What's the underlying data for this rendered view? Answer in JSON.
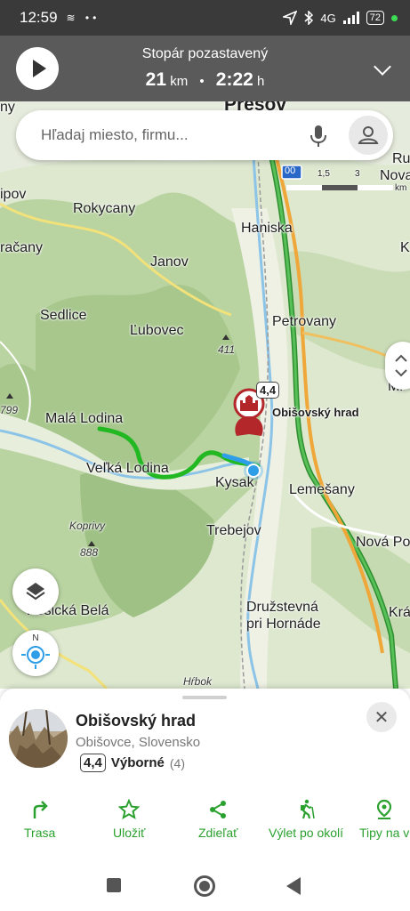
{
  "status_bar": {
    "time": "12:59",
    "left_icons": "≋ ••",
    "network": "4G",
    "battery": "72"
  },
  "tracker": {
    "title": "Stopár pozastavený",
    "distance_value": "21",
    "distance_unit": "km",
    "separator": "•",
    "duration_value": "2:22",
    "duration_unit": "h"
  },
  "search": {
    "placeholder": "Hľadaj miesto, firmu..."
  },
  "map": {
    "places": [
      {
        "id": "presov",
        "label": "Prešov"
      },
      {
        "id": "rokycany",
        "label": "Rokycany"
      },
      {
        "id": "haniska",
        "label": "Haniska"
      },
      {
        "id": "janov",
        "label": "Janov"
      },
      {
        "id": "sedlice",
        "label": "Sedlice"
      },
      {
        "id": "lubovec",
        "label": "Ľubovec"
      },
      {
        "id": "petrovany",
        "label": "Petrovany"
      },
      {
        "id": "mala-lodina",
        "label": "Malá Lodina"
      },
      {
        "id": "velka-lodina",
        "label": "Veľká Lodina"
      },
      {
        "id": "kysak",
        "label": "Kysak"
      },
      {
        "id": "lemesany",
        "label": "Lemešany"
      },
      {
        "id": "koprivy",
        "label": "Koprivy"
      },
      {
        "id": "trebejov",
        "label": "Trebejov"
      },
      {
        "id": "nova-polhora",
        "label": "Nová Po"
      },
      {
        "id": "druzstevna",
        "label": "Družstevná"
      },
      {
        "id": "pri-hornade",
        "label": "pri Hornáde"
      },
      {
        "id": "kosicka-bela",
        "label": "Košická Belá"
      },
      {
        "id": "hrbok",
        "label": "Hŕbok"
      },
      {
        "id": "ipov",
        "label": "ipov"
      },
      {
        "id": "racany",
        "label": "račany"
      },
      {
        "id": "ny",
        "label": "ny"
      },
      {
        "id": "ru",
        "label": "Ru"
      },
      {
        "id": "nova",
        "label": "Nova"
      },
      {
        "id": "ka",
        "label": "K"
      },
      {
        "id": "mi",
        "label": "Mi"
      },
      {
        "id": "kra",
        "label": "Krá"
      }
    ],
    "elevations": {
      "e411": "411",
      "e799": "799",
      "e888": "888"
    },
    "road_number": "00",
    "scale_labels": [
      "1,5",
      "3",
      "km"
    ],
    "poi": {
      "name": "Obišovský hrad",
      "rating": "4,4"
    },
    "route_color": "#22b822",
    "location_color": "#2f9ee8"
  },
  "place_card": {
    "name": "Obišovský hrad",
    "address": "Obišovce, Slovensko",
    "rating": "4,4",
    "rating_label": "Výborné",
    "rating_count": "(4)"
  },
  "actions": [
    {
      "id": "route",
      "label": "Trasa",
      "icon": "turn-right-arrow-icon"
    },
    {
      "id": "save",
      "label": "Uložiť",
      "icon": "star-icon"
    },
    {
      "id": "share",
      "label": "Zdieľať",
      "icon": "share-icon"
    },
    {
      "id": "trip",
      "label": "Výlet po okolí",
      "icon": "hiker-icon"
    },
    {
      "id": "tips",
      "label": "Tipy na v",
      "icon": "map-pin-icon"
    }
  ],
  "accent_color": "#2aa12e"
}
